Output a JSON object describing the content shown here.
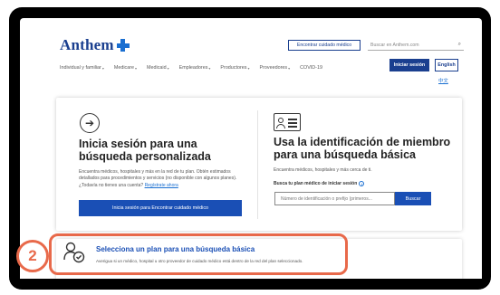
{
  "header": {
    "logo_text": "Anthem",
    "find_doctor_label": "Encontrar cuidado médico",
    "search_placeholder": "Buscar en Anthem.com",
    "login_label": "Iniciar sesión",
    "english_label": "English",
    "chinese_label": "中文"
  },
  "nav": {
    "items": [
      {
        "label": "Individual y familiar",
        "has_caret": true
      },
      {
        "label": "Medicare",
        "has_caret": true
      },
      {
        "label": "Medicaid",
        "has_caret": true
      },
      {
        "label": "Empleadores",
        "has_caret": true
      },
      {
        "label": "Productores",
        "has_caret": true
      },
      {
        "label": "Proveedores",
        "has_caret": true
      },
      {
        "label": "COVID-19",
        "has_caret": false
      }
    ],
    "caret_glyph": "▾"
  },
  "login_panel": {
    "title": "Inicia sesión para una búsqueda personalizada",
    "desc_main": "Encuentra médicos, hospitales y más en la red de tu plan. Obtén estimados detallados para procedimientos y servicios (no disponible con algunos planes). ¿Todavía no tienes una cuenta?",
    "desc_link": "Regístrate ahora",
    "button_label": "Inicia sesión para Encontrar cuidado médico"
  },
  "id_panel": {
    "title": "Usa la identificación de miembro para una búsqueda básica",
    "desc": "Encuentra médicos, hospitales y más cerca de ti.",
    "field_label": "Busca tu plan médico de iniciar sesión",
    "input_placeholder": "Número de identificación o prefijo (primeros...",
    "search_button_label": "Buscar"
  },
  "plan_panel": {
    "step_number": "2",
    "title": "Selecciona un plan para una búsqueda básica",
    "desc": "Averigua si un médico, hospital u otro proveedor de cuidado médico está dentro de la red del plan seleccionado."
  },
  "colors": {
    "brand_blue": "#1a3f8f",
    "button_blue": "#1a4fb5",
    "highlight_orange": "#e8694a"
  }
}
